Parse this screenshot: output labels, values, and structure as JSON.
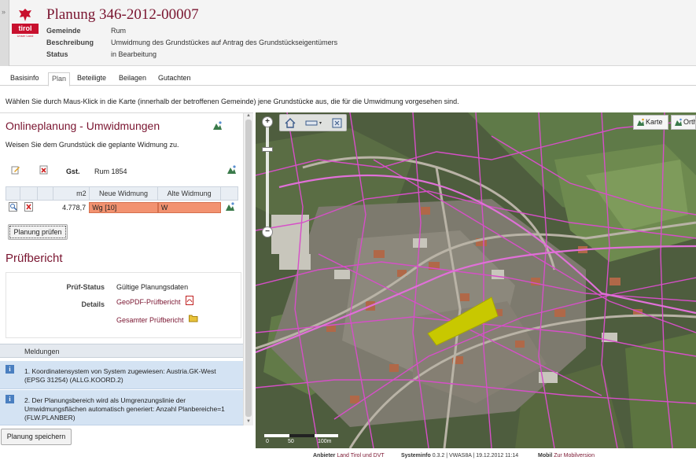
{
  "header": {
    "title": "Planung 346-2012-00007",
    "logo_text": "tirol",
    "logo_sub": "Unser Land",
    "fields": [
      {
        "label": "Gemeinde",
        "value": "Rum"
      },
      {
        "label": "Beschreibung",
        "value": "Umwidmung des Grundstückes auf Antrag des Grundstückseigentümers"
      },
      {
        "label": "Status",
        "value": "in Bearbeitung"
      }
    ]
  },
  "tabs": [
    {
      "label": "Basisinfo",
      "active": false
    },
    {
      "label": "Plan",
      "active": true
    },
    {
      "label": "Beteiligte",
      "active": false
    },
    {
      "label": "Beilagen",
      "active": false
    },
    {
      "label": "Gutachten",
      "active": false
    }
  ],
  "instruction": "Wählen Sie durch Maus-Klick in die Karte (innerhalb der betroffenen Gemeinde) jene Grundstücke aus, die für die Umwidmung vorgesehen sind.",
  "online": {
    "title": "Onlineplanung - Umwidmungen",
    "subtitle": "Weisen Sie dem Grundstück die geplante Widmung zu.",
    "gst_label": "Gst.",
    "gst_value": "Rum 1854",
    "table": {
      "headers": [
        "",
        "",
        "",
        "m2",
        "Neue Widmung",
        "Alte Widmung"
      ],
      "rows": [
        {
          "m2": "4.778,7",
          "neue": "Wg [10]",
          "alte": "W"
        }
      ]
    },
    "check_button": "Planung prüfen"
  },
  "pruef": {
    "title": "Prüfbericht",
    "status_label": "Prüf-Status",
    "status_value": "Gültige Planungsdaten",
    "details_label": "Details",
    "link_geopdf": "GeoPDF-Prüfbericht",
    "link_gesamt": "Gesamter Prüfbericht"
  },
  "meldungen": {
    "header": "Meldungen",
    "items": [
      {
        "icon": "info-icon",
        "text": "1. Koordinatensystem von System zugewiesen: Austria.GK-West (EPSG 31254) (ALLG.KOORD.2)"
      },
      {
        "icon": "info-icon",
        "text": "2. Der Planungsbereich wird als Umgrenzungslinie der Umwidmungsflächen automatisch generiert: Anzahl Planbereiche=1 (FLW.PLANBER)"
      }
    ]
  },
  "save_button": "Planung speichern",
  "map": {
    "karte_button": "Karte",
    "ortho_button": "Orthofoto",
    "scale_labels": [
      "0",
      "50",
      "100m"
    ],
    "colors": {
      "parcel_lines": "#d64fc8",
      "selected_parcel": "#c8c800",
      "aerial_base": "#4c5a3c"
    }
  },
  "footer": {
    "anbieter_label": "Anbieter",
    "anbieter_value": "Land Tirol und DVT",
    "sysinfo_label": "Systeminfo",
    "sysinfo_value": "0.3.2 | VWAS8A | 19.12.2012 11:14",
    "mobil_label": "Mobil",
    "mobil_value": "Zur Mobilversion"
  }
}
